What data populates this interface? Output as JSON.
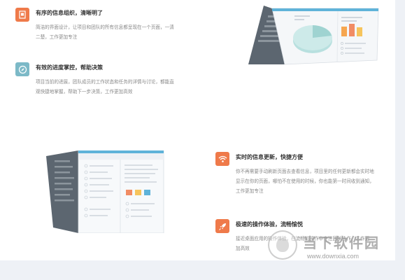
{
  "features": [
    {
      "icon": "document-icon",
      "color": "#ef7a4a",
      "title": "有序的信息组织，清晰明了",
      "desc_lines": [
        "简洁的界面设计，让项目和团队的所有信息都呈现在一个页面，一清",
        "二楚，工作更加专注"
      ]
    },
    {
      "icon": "compass-icon",
      "color": "#7cb9c7",
      "title": "有效的进度掌控，帮助决策",
      "desc_lines": [
        "项目当前的进展，团队成员的工作状态和任务的详情与讨论，都能直",
        "观快捷地掌握，帮助下一步决策，工作更加高效"
      ]
    },
    {
      "icon": "wifi-icon",
      "color": "#ef7a4a",
      "title": "实时的信息更新，快捷方便",
      "desc_lines": [
        "你不再需要手动刷新页面去查看信息，项目里的任何更新都会实时地",
        "显示在你的页面，哪怕不在使用的时候，你也能第一时间收到通知，",
        "工作更加专注"
      ]
    },
    {
      "icon": "rocket-icon",
      "color": "#ef7a4a",
      "title": "极速的操作体验，流畅愉悦",
      "desc_lines": [
        "接近桌面应用的操作体验，在流畅的操作中专注团队协作，工作更",
        "加高效"
      ]
    }
  ],
  "watermark": {
    "name": "当下软件园",
    "url": "www.downxia.com"
  }
}
